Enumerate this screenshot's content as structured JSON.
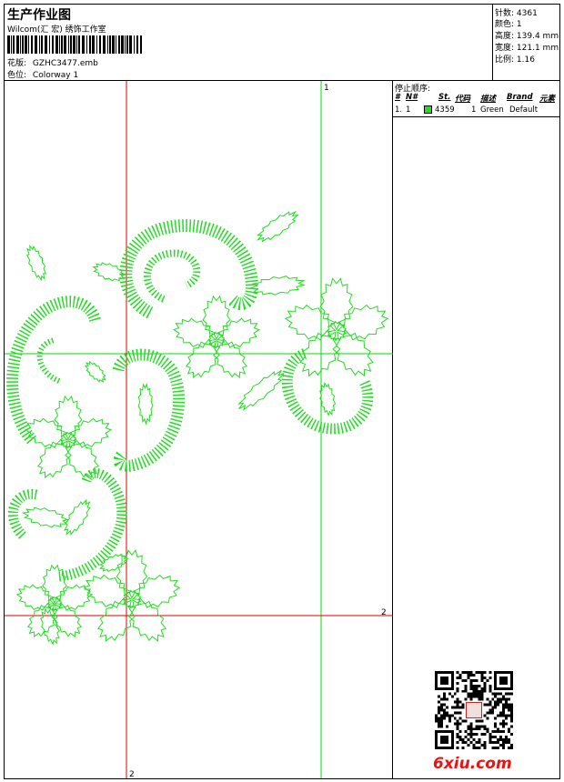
{
  "header": {
    "title": "生产作业图",
    "software": "Wilcom(汇 宏) 绣饰工作室",
    "design_label": "花版:",
    "design_file": "GZHC3477.emb",
    "colorway_label": "色位:",
    "colorway": "Colorway 1"
  },
  "stats": [
    {
      "label": "针数:",
      "value": "4361"
    },
    {
      "label": "颜色:",
      "value": "1"
    },
    {
      "label": "高度:",
      "value": "139.4 mm"
    },
    {
      "label": "宽度:",
      "value": "121.1 mm"
    },
    {
      "label": "比例:",
      "value": "1.16"
    }
  ],
  "stop_sequence": {
    "title": "停止顺序:",
    "columns": [
      "#",
      "N#",
      "St.",
      "代码",
      "描述",
      "Brand",
      "元素"
    ],
    "rows": [
      {
        "num": "1.",
        "n": "1",
        "color": "#22dd22",
        "stitches": "4359",
        "code": "1",
        "description": "Green",
        "brand": "Default",
        "element": ""
      }
    ]
  },
  "guides": {
    "vertical_top_label": "1",
    "horizontal_right_label": "2",
    "vertical_bottom_label": "2"
  },
  "watermark": {
    "text": "6xiu.com"
  },
  "colors": {
    "stitch": "#22dd22",
    "guide_green": "#00dd00",
    "guide_red": "#dd0000",
    "watermark": "#ee1111"
  }
}
